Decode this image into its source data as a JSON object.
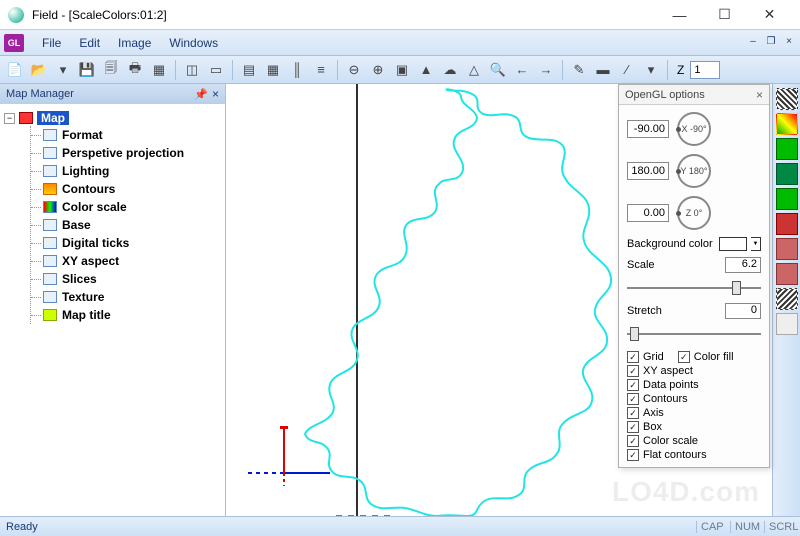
{
  "window": {
    "title": "Field - [ScaleColors:01:2]",
    "min": "—",
    "max": "☐",
    "close": "✕"
  },
  "menus": {
    "badge": "GL",
    "items": [
      "File",
      "Edit",
      "Image",
      "Windows"
    ]
  },
  "toolbar": {
    "z_label": "Z",
    "z_value": "1"
  },
  "map_manager": {
    "title": "Map Manager",
    "root": "Map",
    "items": [
      {
        "label": "Format",
        "icon": ""
      },
      {
        "label": "Perspetive projection",
        "icon": ""
      },
      {
        "label": "Lighting",
        "icon": ""
      },
      {
        "label": "Contours",
        "icon": "contours"
      },
      {
        "label": "Color scale",
        "icon": "colorscale"
      },
      {
        "label": "Base",
        "icon": ""
      },
      {
        "label": "Digital ticks",
        "icon": ""
      },
      {
        "label": "XY aspect",
        "icon": ""
      },
      {
        "label": "Slices",
        "icon": ""
      },
      {
        "label": "Texture",
        "icon": ""
      },
      {
        "label": "Map title",
        "icon": "maptitle"
      }
    ]
  },
  "gl_panel": {
    "title": "OpenGL options",
    "rotX": {
      "value": "-90.00",
      "dial": "X -90°"
    },
    "rotY": {
      "value": "180.00",
      "dial": "Y 180°"
    },
    "rotZ": {
      "value": "0.00",
      "dial": "Z 0°"
    },
    "bg_label": "Background color",
    "scale_label": "Scale",
    "scale_value": "6.2",
    "stretch_label": "Stretch",
    "stretch_value": "0",
    "checks": {
      "grid": "Grid",
      "color_fill": "Color fill",
      "xy_aspect": "XY aspect",
      "data_points": "Data points",
      "contours": "Contours",
      "axis": "Axis",
      "box": "Box",
      "color_scale": "Color scale",
      "flat_contours": "Flat contours"
    }
  },
  "status": {
    "ready": "Ready",
    "cap": "CAP",
    "num": "NUM",
    "scrl": "SCRL"
  },
  "watermark": "LO4D.com"
}
